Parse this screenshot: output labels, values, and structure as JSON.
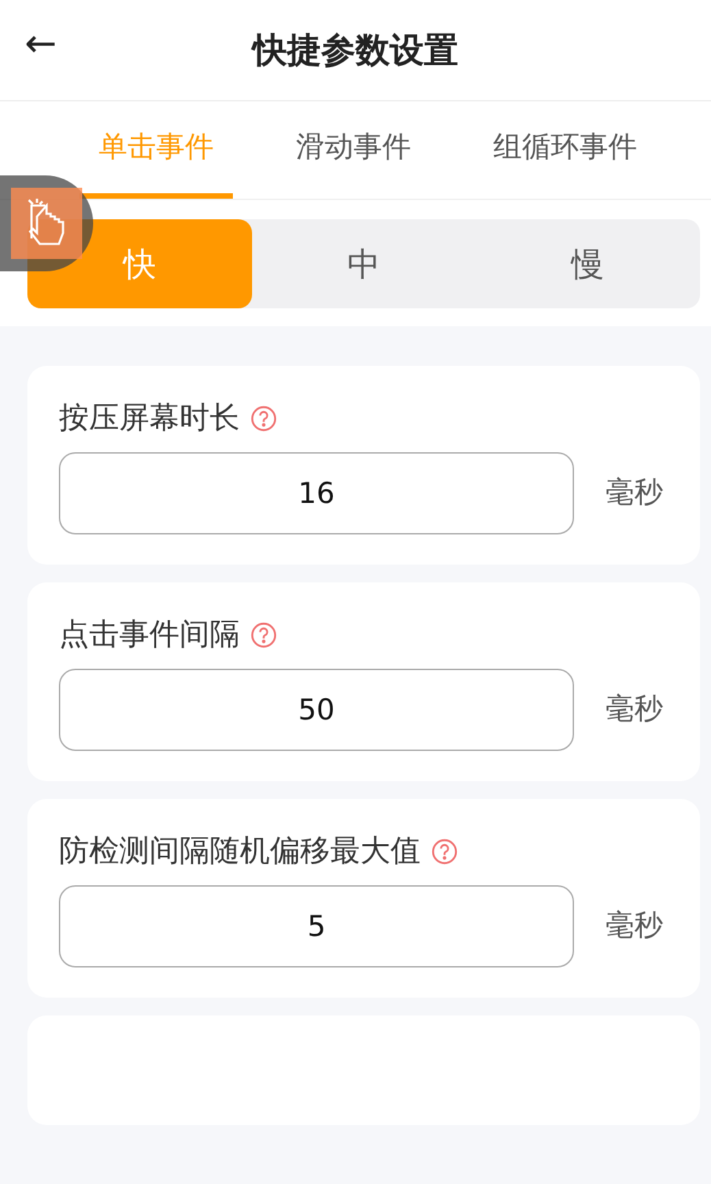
{
  "header": {
    "back_icon": "←",
    "title": "快捷参数设置"
  },
  "tabs": [
    {
      "label": "单击事件",
      "selected": true
    },
    {
      "label": "滑动事件",
      "selected": false
    },
    {
      "label": "组循环事件",
      "selected": false
    }
  ],
  "speeds": [
    {
      "label": "快",
      "selected": true
    },
    {
      "label": "中",
      "selected": false
    },
    {
      "label": "慢",
      "selected": false
    }
  ],
  "settings": [
    {
      "label": "按压屏幕时长",
      "value": "16",
      "unit": "毫秒"
    },
    {
      "label": "点击事件间隔",
      "value": "50",
      "unit": "毫秒"
    },
    {
      "label": "防检测间隔随机偏移最大值",
      "value": "5",
      "unit": "毫秒"
    }
  ]
}
